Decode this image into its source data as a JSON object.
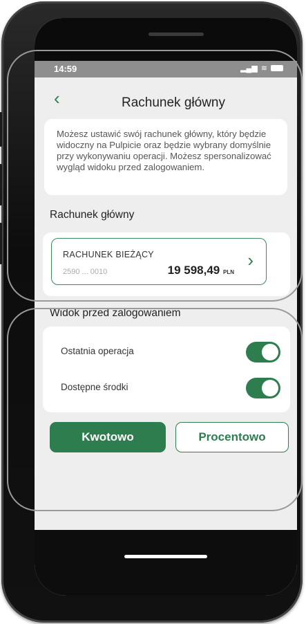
{
  "status_bar": {
    "time": "14:59",
    "signal": "▂▄▆",
    "wifi": "≋"
  },
  "header": {
    "back_icon": "‹",
    "title": "Rachunek główny"
  },
  "info": {
    "text": "Możesz ustawić swój rachunek główny, który będzie widoczny na Pulpicie oraz będzie wybrany domyślnie przy wykonywaniu operacji. Możesz spersonalizować wygląd widoku przed zalogowaniem."
  },
  "main_account_section": {
    "label": "Rachunek główny"
  },
  "account": {
    "name": "RACHUNEK BIEŻĄCY",
    "number": "2590 ... 0010",
    "balance": "19 598,49",
    "currency": "PLN",
    "chevron": "›"
  },
  "pre_login_section": {
    "label": "Widok przed zalogowaniem"
  },
  "toggles": [
    {
      "label": "Ostatnia operacja",
      "on": true
    },
    {
      "label": "Dostępne środki",
      "on": true
    }
  ],
  "buttons": {
    "amount": "Kwotowo",
    "percent": "Procentowo"
  },
  "colors": {
    "accent": "#2e7d4f",
    "background": "#eeeeee",
    "card": "#ffffff"
  }
}
